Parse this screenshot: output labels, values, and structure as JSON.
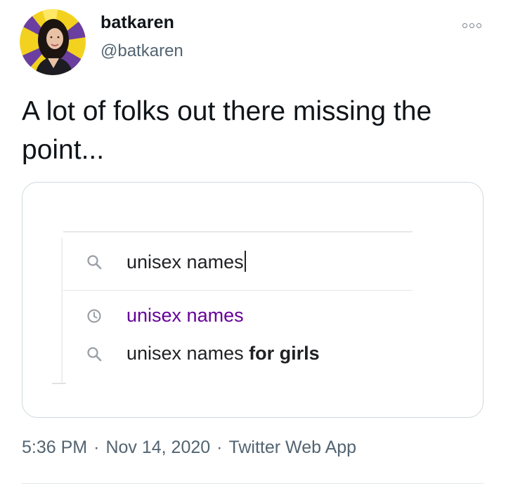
{
  "tweet": {
    "author": {
      "display_name": "batkaren",
      "handle": "@batkaren"
    },
    "more_icon": "more-horizontal-icon",
    "text": "A lot of folks out there missing the point...",
    "media": {
      "search_query": "unisex names",
      "suggestions": [
        {
          "icon": "history-clock-icon",
          "text": "unisex names",
          "bold": ""
        },
        {
          "icon": "search-icon",
          "text": "unisex names ",
          "bold": "for girls"
        }
      ],
      "colors": {
        "history_link": "#660099",
        "text": "#202124",
        "icon": "#9aa0a6"
      }
    },
    "meta": {
      "time": "5:36 PM",
      "date": "Nov 14, 2020",
      "source": "Twitter Web App",
      "separator": "·"
    }
  }
}
